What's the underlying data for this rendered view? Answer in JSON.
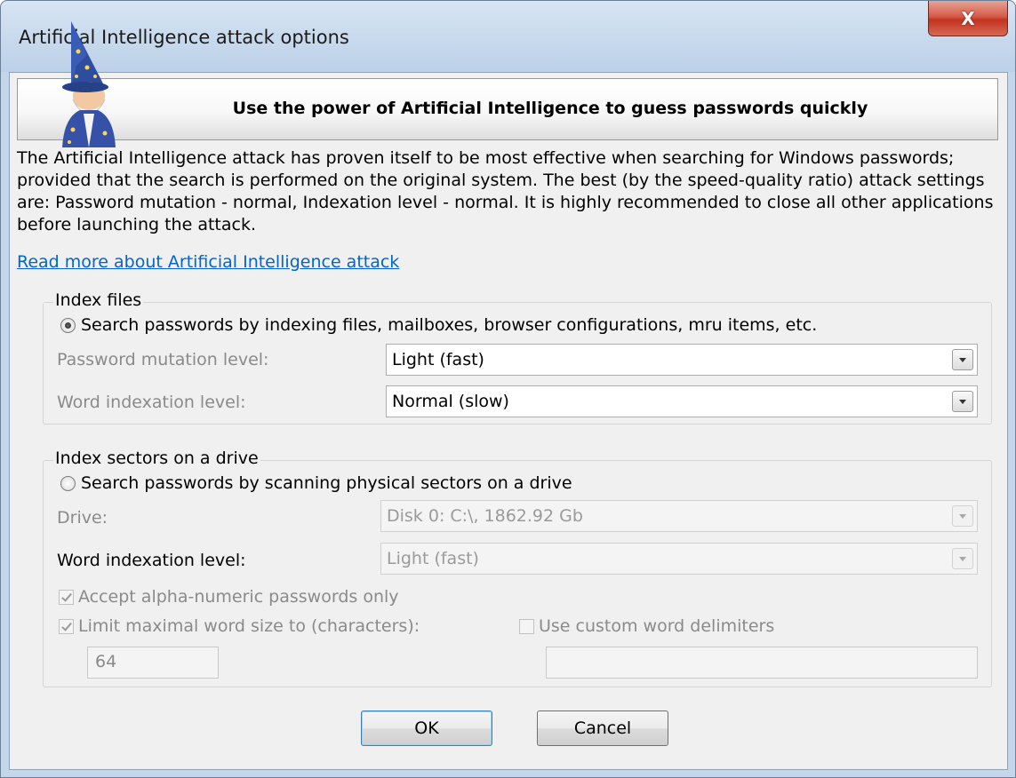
{
  "window": {
    "title": "Artificial Intelligence attack options",
    "close_glyph": "X"
  },
  "banner": {
    "icon": "wizard-icon",
    "text": "Use the power of Artificial Intelligence to guess passwords quickly"
  },
  "description": "The Artificial Intelligence attack has proven itself to be most effective when searching for Windows passwords; provided that the search is performed on the original system. The best (by the speed-quality ratio) attack settings are: Password mutation - normal, Indexation level - normal. It is highly recommended to close all other applications before launching the attack.",
  "link_text": "Read more about Artificial Intelligence attack",
  "index_files": {
    "group_label": "Index files",
    "radio_label": "Search passwords by indexing files, mailboxes, browser configurations, mru items, etc.",
    "radio_checked": true,
    "mutation_label": "Password mutation level:",
    "mutation_value": "Light (fast)",
    "word_label": "Word indexation level:",
    "word_value": "Normal (slow)"
  },
  "index_sectors": {
    "group_label": "Index sectors on a drive",
    "radio_label": "Search passwords by scanning physical sectors on a drive",
    "radio_checked": false,
    "drive_label": "Drive:",
    "drive_value": "Disk 0:  C:\\, 1862.92 Gb",
    "word_label": "Word indexation level:",
    "word_value": "Light (fast)",
    "alpha_label": "Accept alpha-numeric passwords only",
    "alpha_checked": true,
    "limit_label": "Limit maximal word size to (characters):",
    "limit_checked": true,
    "limit_value": "64",
    "delim_label": "Use custom word delimiters",
    "delim_checked": false,
    "delim_value": ""
  },
  "buttons": {
    "ok": "OK",
    "cancel": "Cancel"
  }
}
